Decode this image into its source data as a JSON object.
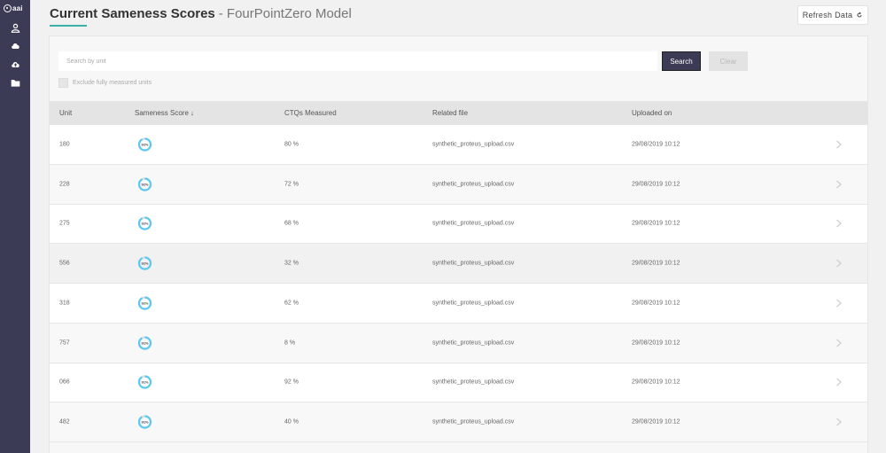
{
  "sidebar": {
    "logo_text": "aai",
    "items": [
      {
        "icon": "user-icon"
      },
      {
        "icon": "cloud-icon"
      },
      {
        "icon": "cloud-upload-icon"
      },
      {
        "icon": "folder-icon"
      }
    ]
  },
  "header": {
    "title": "Current Sameness Scores",
    "subtitle": "- FourPointZero Model",
    "refresh_label": "Refresh Data",
    "accent_color": "#3ab2a8"
  },
  "search": {
    "placeholder": "Search by unit",
    "value": "",
    "search_label": "Search",
    "clear_label": "Clear",
    "exclude_label": "Exclude fully measured units"
  },
  "table": {
    "columns": [
      "Unit",
      "Sameness Score",
      "CTQs Measured",
      "Related file",
      "Uploaded on"
    ],
    "sort_indicator": "↓",
    "rows": [
      {
        "unit": "180",
        "score": "92%",
        "score_value": 0.92,
        "ctqs": "80 %",
        "file": "synthetic_proteus_upload.csv",
        "uploaded": "29/08/2019 10:12"
      },
      {
        "unit": "228",
        "score": "92%",
        "score_value": 0.92,
        "ctqs": "72 %",
        "file": "synthetic_proteus_upload.csv",
        "uploaded": "29/08/2019 10:12"
      },
      {
        "unit": "275",
        "score": "92%",
        "score_value": 0.92,
        "ctqs": "68 %",
        "file": "synthetic_proteus_upload.csv",
        "uploaded": "29/08/2019 10:12"
      },
      {
        "unit": "556",
        "score": "92%",
        "score_value": 0.92,
        "ctqs": "32 %",
        "file": "synthetic_proteus_upload.csv",
        "uploaded": "29/08/2019 10:12"
      },
      {
        "unit": "318",
        "score": "92%",
        "score_value": 0.92,
        "ctqs": "62 %",
        "file": "synthetic_proteus_upload.csv",
        "uploaded": "29/08/2019 10:12"
      },
      {
        "unit": "757",
        "score": "91%",
        "score_value": 0.91,
        "ctqs": "8 %",
        "file": "synthetic_proteus_upload.csv",
        "uploaded": "29/08/2019 10:12"
      },
      {
        "unit": "066",
        "score": "91%",
        "score_value": 0.91,
        "ctqs": "92 %",
        "file": "synthetic_proteus_upload.csv",
        "uploaded": "29/08/2019 10:12"
      },
      {
        "unit": "482",
        "score": "91%",
        "score_value": 0.91,
        "ctqs": "40 %",
        "file": "synthetic_proteus_upload.csv",
        "uploaded": "29/08/2019 10:12"
      }
    ]
  },
  "colors": {
    "sidebar": "#3b3b56",
    "gauge": "#5ac8f0",
    "gauge_track": "#dcdcdc",
    "search_button": "#3b3b56"
  }
}
